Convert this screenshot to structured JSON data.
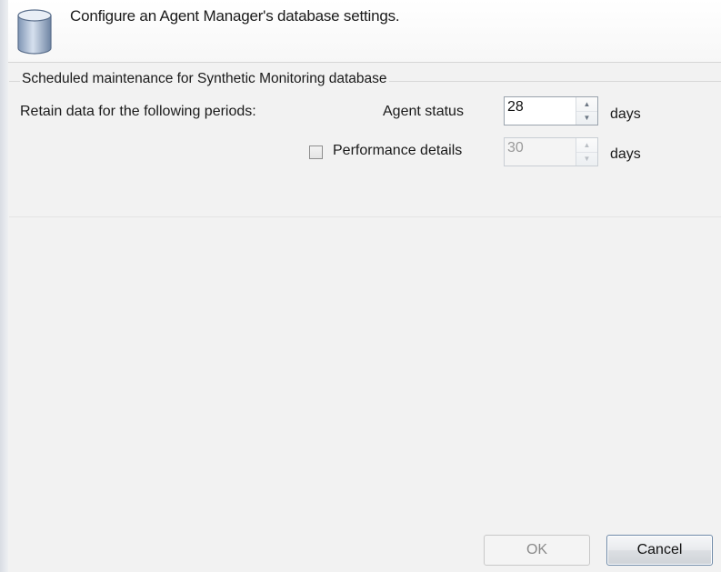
{
  "header": {
    "icon": "database-icon",
    "title": "Configure an Agent Manager's database settings."
  },
  "maintenance": {
    "group_title": "Scheduled maintenance for Synthetic Monitoring database",
    "retain_label": "Retain data for the following periods:",
    "agent_status": {
      "label": "Agent status",
      "value": "28",
      "unit": "days"
    },
    "performance_details": {
      "label": "Performance details",
      "checked": false,
      "value": "30",
      "unit": "days",
      "enabled": false
    }
  },
  "buttons": {
    "ok_label": "OK",
    "ok_enabled": false,
    "cancel_label": "Cancel"
  },
  "colors": {
    "window_bg": "#f2f2f2",
    "header_bg": "#ffffff",
    "cancel_border": "#6f8aa8",
    "disabled_text": "#9a9a9a"
  }
}
